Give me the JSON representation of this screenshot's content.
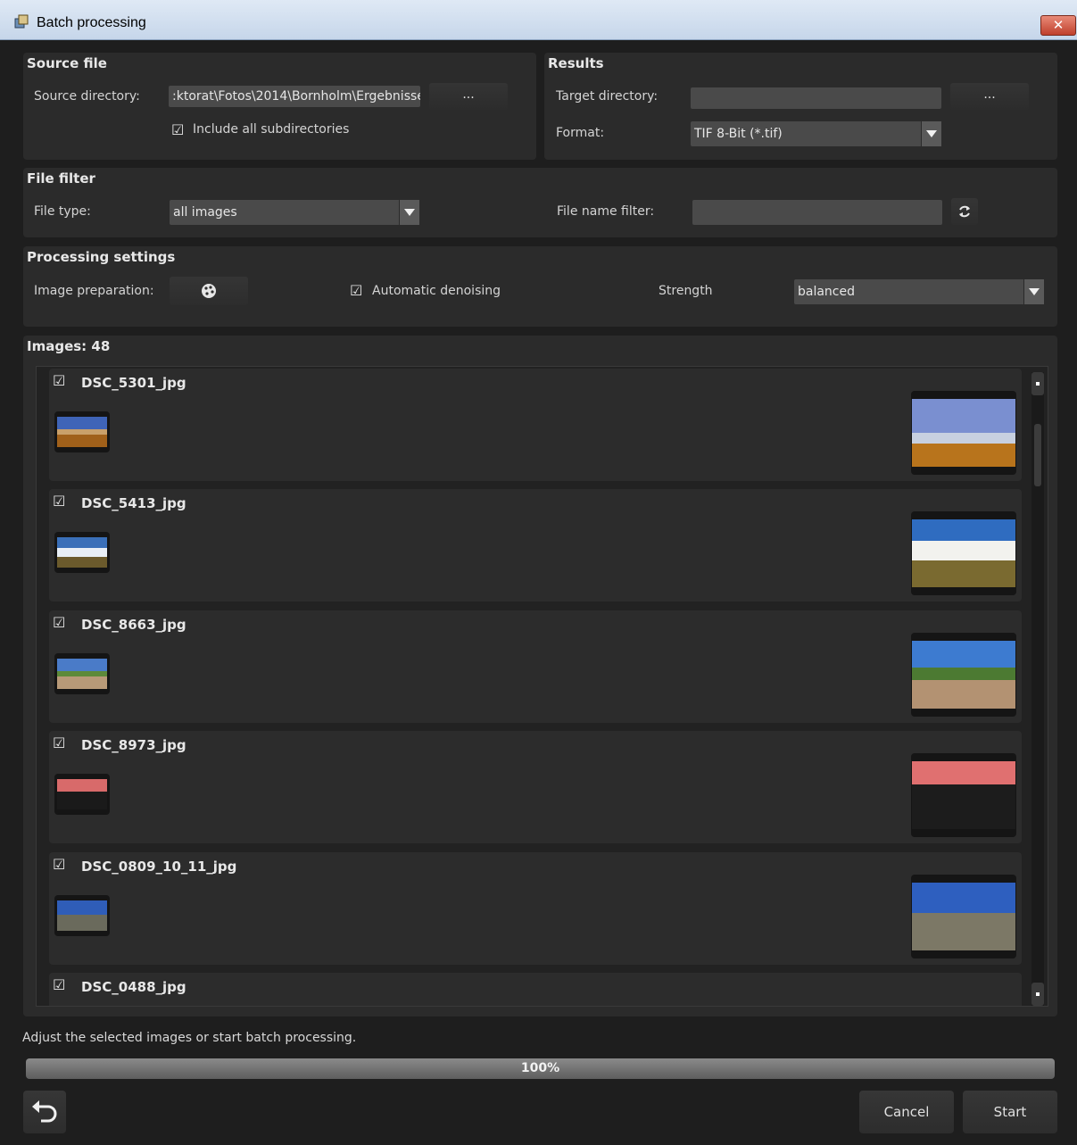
{
  "window": {
    "title": "Batch processing",
    "close_glyph": "✕"
  },
  "source": {
    "title": "Source file",
    "dir_label": "Source directory:",
    "dir_value": ":ktorat\\Fotos\\2014\\Bornholm\\Ergebnisse",
    "browse_label": "...",
    "subdirs_label": "Include all subdirectories",
    "subdirs_checked": true
  },
  "results": {
    "title": "Results",
    "target_label": "Target directory:",
    "target_value": "",
    "browse_label": "...",
    "format_label": "Format:",
    "format_value": "TIF 8-Bit (*.tif)"
  },
  "filter": {
    "title": "File filter",
    "type_label": "File type:",
    "type_value": "all images",
    "name_label": "File name filter:",
    "name_value": ""
  },
  "processing": {
    "title": "Processing settings",
    "prep_label": "Image preparation:",
    "denoise_label": "Automatic denoising",
    "denoise_checked": true,
    "strength_label": "Strength",
    "strength_value": "balanced"
  },
  "images": {
    "header": "Images: 48",
    "items": [
      {
        "name": "DSC_5301_jpg",
        "checked": true
      },
      {
        "name": "DSC_5413_jpg",
        "checked": true
      },
      {
        "name": "DSC_8663_jpg",
        "checked": true
      },
      {
        "name": "DSC_8973_jpg",
        "checked": true
      },
      {
        "name": "DSC_0809_10_11_jpg",
        "checked": true
      },
      {
        "name": "DSC_0488_jpg",
        "checked": true
      }
    ]
  },
  "status_text": "Adjust the selected images or start batch processing.",
  "progress": {
    "value": 1.0,
    "label": "100%"
  },
  "buttons": {
    "undo_icon": "undo-icon",
    "cancel": "Cancel",
    "start": "Start"
  },
  "icons": {
    "checkbox": "checkbox-checked-icon",
    "refresh": "refresh-icon",
    "palette": "palette-icon",
    "app": "app-icon"
  }
}
